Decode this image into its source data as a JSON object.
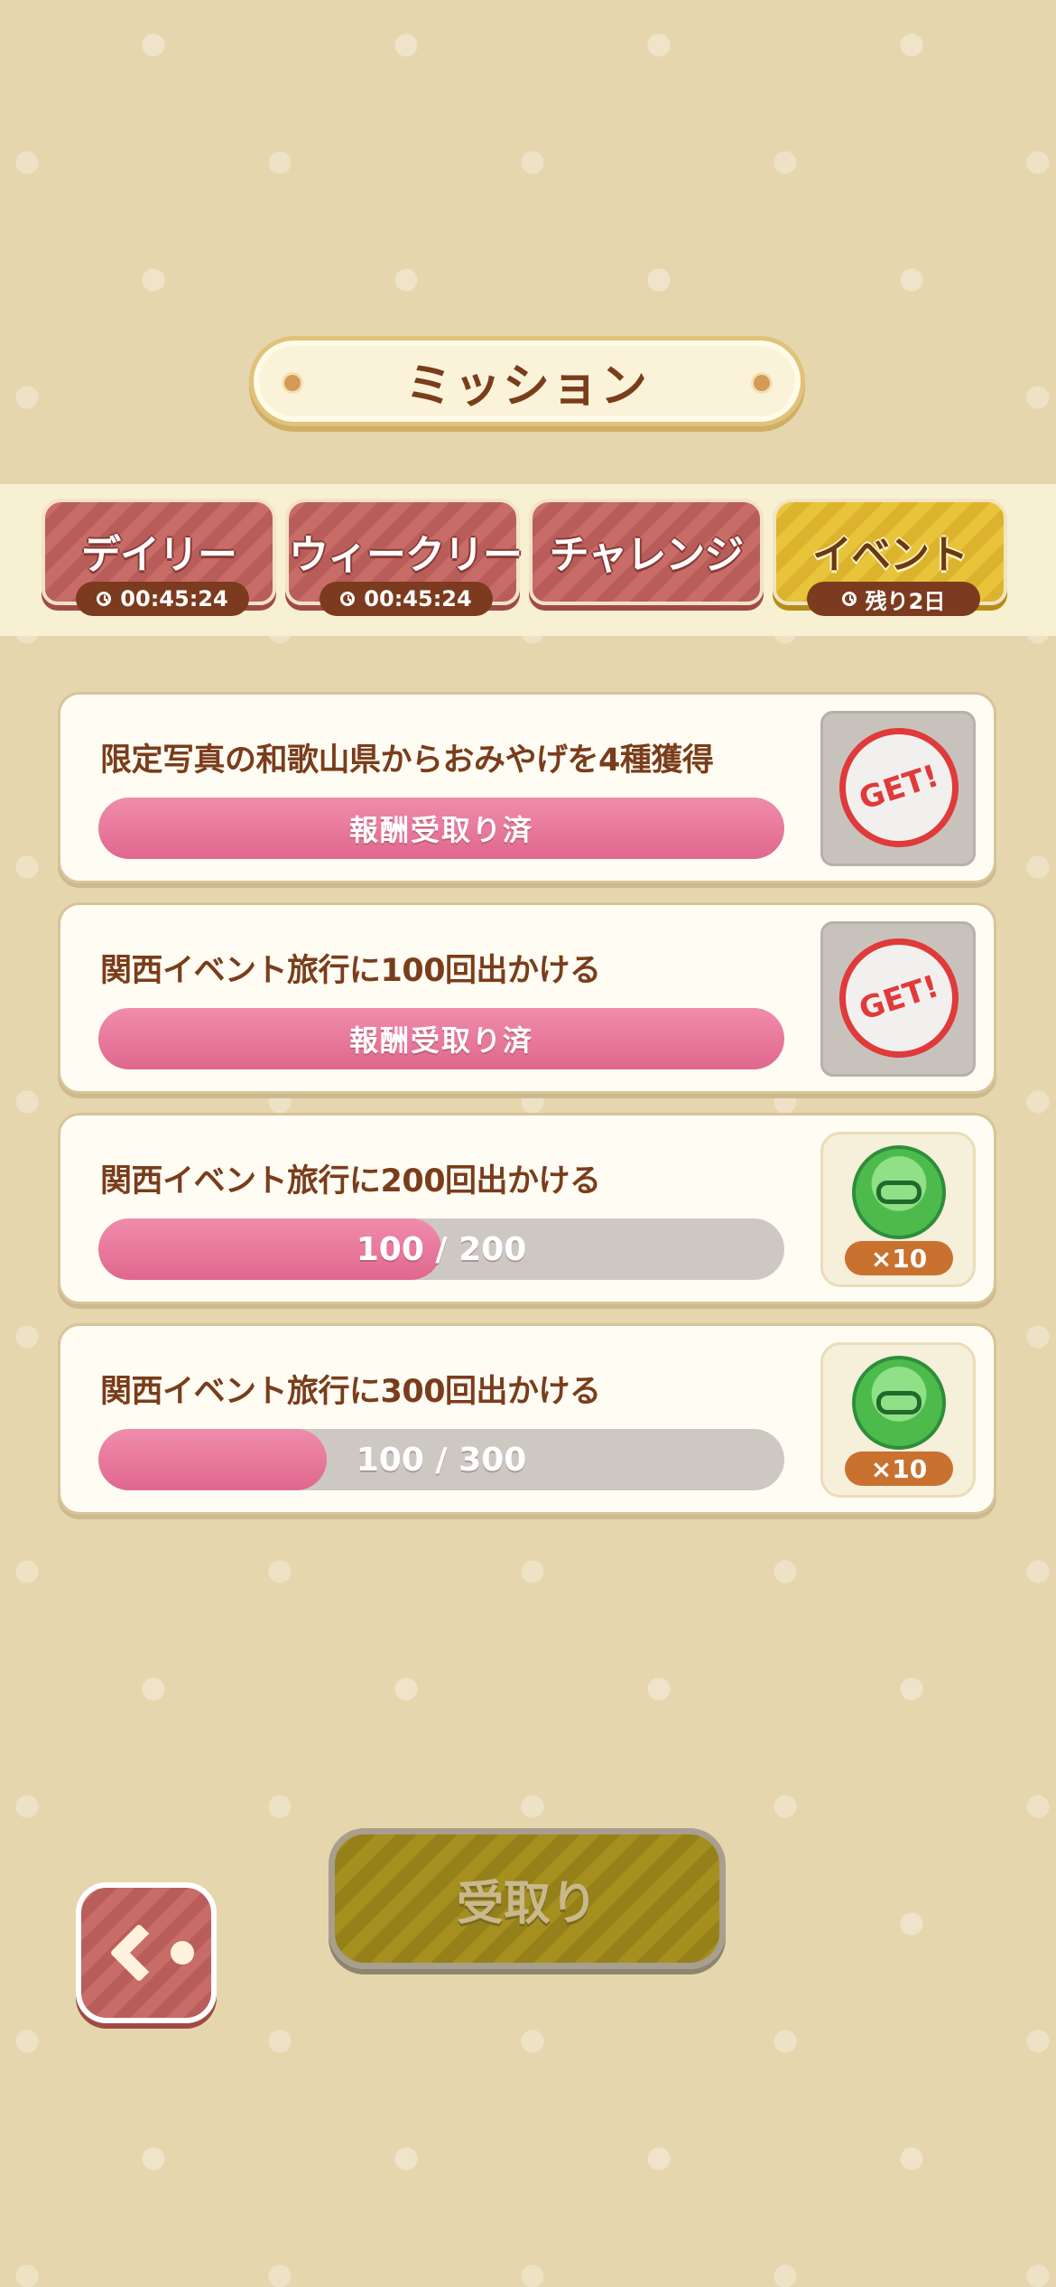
{
  "header": {
    "title": "ミッション"
  },
  "tabs": [
    {
      "label": "デイリー",
      "timer": "00:45:24",
      "active": false
    },
    {
      "label": "ウィークリー",
      "timer": "00:45:24",
      "active": false
    },
    {
      "label": "チャレンジ",
      "timer": "",
      "active": false
    },
    {
      "label": "イベント",
      "timer": "残り2日",
      "active": true
    }
  ],
  "missions": [
    {
      "title": "限定写真の和歌山県からおみやげを4種獲得",
      "status": "報酬受取り済",
      "progress": 1.0,
      "reward": {
        "state": "claimed",
        "stamp": "GET!"
      }
    },
    {
      "title": "関西イベント旅行に100回出かける",
      "status": "報酬受取り済",
      "progress": 1.0,
      "reward": {
        "state": "claimed",
        "stamp": "GET!"
      }
    },
    {
      "title": "関西イベント旅行に200回出かける",
      "status": "100 / 200",
      "progress": 0.5,
      "reward": {
        "state": "available",
        "icon": "green-coin-icon",
        "quantity": "×10"
      }
    },
    {
      "title": "関西イベント旅行に300回出かける",
      "status": "100 / 300",
      "progress": 0.3333,
      "reward": {
        "state": "available",
        "icon": "green-coin-icon",
        "quantity": "×10"
      }
    }
  ],
  "buttons": {
    "claim_label": "受取り",
    "back_icon": "back-arrow-icon"
  },
  "colors": {
    "background": "#e6d6ad",
    "tab": "#c86c68",
    "tab_active": "#e8c43a",
    "progress": "#e0678f",
    "title_text": "#7a3d1c"
  }
}
